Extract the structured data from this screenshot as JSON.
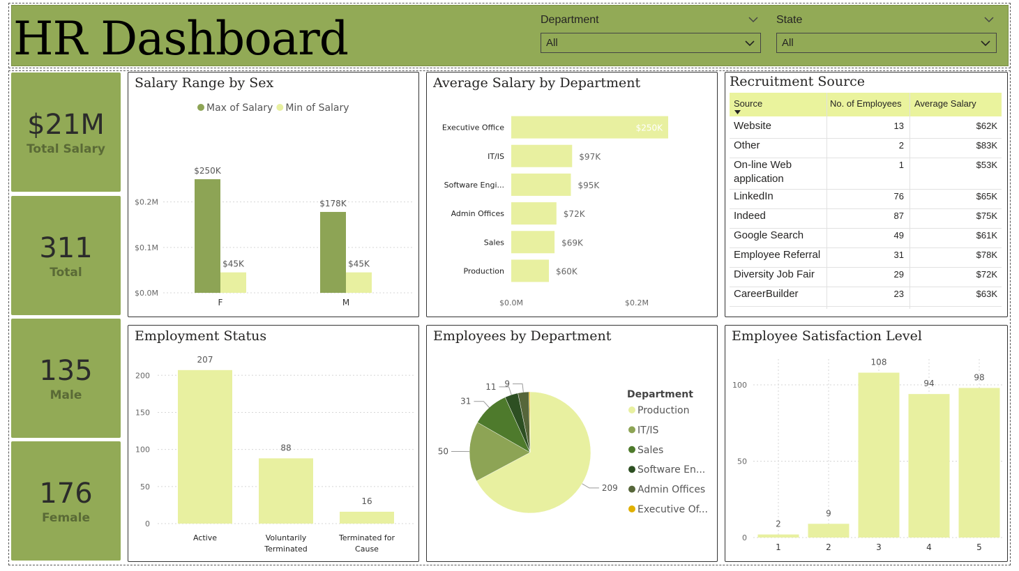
{
  "header": {
    "title": "HR Dashboard",
    "bg": "#92aa56"
  },
  "slicers": [
    {
      "label": "Department",
      "value": "All"
    },
    {
      "label": "State",
      "value": "All"
    }
  ],
  "kpis": [
    {
      "value": "$21M",
      "label": "Total Salary"
    },
    {
      "value": "311",
      "label": "Total"
    },
    {
      "value": "135",
      "label": "Male"
    },
    {
      "value": "176",
      "label": "Female"
    }
  ],
  "chart_titles": {
    "salary_range": "Salary Range by Sex",
    "avg_salary": "Average Salary by Department",
    "recruitment": "Recruitment Source",
    "employment": "Employment Status",
    "emp_dept": "Employees by Department",
    "satisfaction": "Employee Satisfaction Level"
  },
  "chart_data": [
    {
      "id": "salary_range",
      "type": "bar",
      "title": "Salary Range by Sex",
      "categories": [
        "F",
        "M"
      ],
      "series": [
        {
          "name": "Max of Salary",
          "values": [
            250000,
            178000
          ],
          "labels": [
            "$250K",
            "$178K"
          ],
          "color": "#8da455"
        },
        {
          "name": "Min of Salary",
          "values": [
            45000,
            45000
          ],
          "labels": [
            "$45K",
            "$45K"
          ],
          "color": "#e8f0a0"
        }
      ],
      "yticks": [
        "$0.0M",
        "$0.1M",
        "$0.2M"
      ],
      "ytick_values": [
        0,
        100000,
        200000
      ],
      "ylim": [
        0,
        270000
      ],
      "legend": "top"
    },
    {
      "id": "avg_salary",
      "type": "bar",
      "orientation": "horizontal",
      "title": "Average Salary by Department",
      "categories": [
        "Executive Office",
        "IT/IS",
        "Software Engi...",
        "Admin Offices",
        "Sales",
        "Production"
      ],
      "values": [
        250000,
        97000,
        95000,
        72000,
        69000,
        60000
      ],
      "labels": [
        "$250K",
        "$97K",
        "$95K",
        "$72K",
        "$69K",
        "$60K"
      ],
      "xticks": [
        "$0.0M",
        "$0.2M"
      ],
      "xtick_values": [
        0,
        200000
      ],
      "xlim": [
        0,
        250000
      ],
      "color": "#e8f0a0"
    },
    {
      "id": "recruitment",
      "type": "table",
      "title": "Recruitment Source",
      "columns": [
        "Source",
        "No. of Employees",
        "Average Salary"
      ],
      "rows": [
        [
          "Website",
          "13",
          "$62K"
        ],
        [
          "Other",
          "2",
          "$83K"
        ],
        [
          "On-line Web application",
          "1",
          "$53K"
        ],
        [
          "LinkedIn",
          "76",
          "$65K"
        ],
        [
          "Indeed",
          "87",
          "$75K"
        ],
        [
          "Google Search",
          "49",
          "$61K"
        ],
        [
          "Employee Referral",
          "31",
          "$78K"
        ],
        [
          "Diversity Job Fair",
          "29",
          "$72K"
        ],
        [
          "CareerBuilder",
          "23",
          "$63K"
        ]
      ]
    },
    {
      "id": "employment",
      "type": "bar",
      "title": "Employment Status",
      "categories": [
        "Active",
        "Voluntarily Terminated",
        "Terminated for Cause"
      ],
      "category_lines": [
        [
          "Active"
        ],
        [
          "Voluntarily",
          "Terminated"
        ],
        [
          "Terminated for",
          "Cause"
        ]
      ],
      "values": [
        207,
        88,
        16
      ],
      "yticks": [
        "0",
        "50",
        "100",
        "150",
        "200"
      ],
      "ytick_values": [
        0,
        50,
        100,
        150,
        200
      ],
      "ylim": [
        0,
        220
      ],
      "color": "#e8f0a0"
    },
    {
      "id": "emp_dept",
      "type": "pie",
      "title": "Employees by Department",
      "legend_title": "Department",
      "slices": [
        {
          "name": "Production",
          "value": 209,
          "color": "#e8f0a0",
          "label": "209"
        },
        {
          "name": "IT/IS",
          "value": 50,
          "color": "#8da455",
          "label": "50"
        },
        {
          "name": "Sales",
          "value": 31,
          "color": "#4e7a2c",
          "label": "31"
        },
        {
          "name": "Software En...",
          "value": 11,
          "color": "#2d4f22",
          "label": "11"
        },
        {
          "name": "Admin Offices",
          "value": 9,
          "color": "#56663a",
          "label": "9"
        },
        {
          "name": "Executive Of...",
          "value": 1,
          "color": "#e0b000",
          "label": ""
        }
      ]
    },
    {
      "id": "satisfaction",
      "type": "bar",
      "title": "Employee Satisfaction Level",
      "categories": [
        "1",
        "2",
        "3",
        "4",
        "5"
      ],
      "values": [
        2,
        9,
        108,
        94,
        98
      ],
      "yticks": [
        "0",
        "50",
        "100"
      ],
      "ytick_values": [
        0,
        50,
        100
      ],
      "ylim": [
        0,
        116
      ],
      "color": "#e8f0a0"
    }
  ]
}
